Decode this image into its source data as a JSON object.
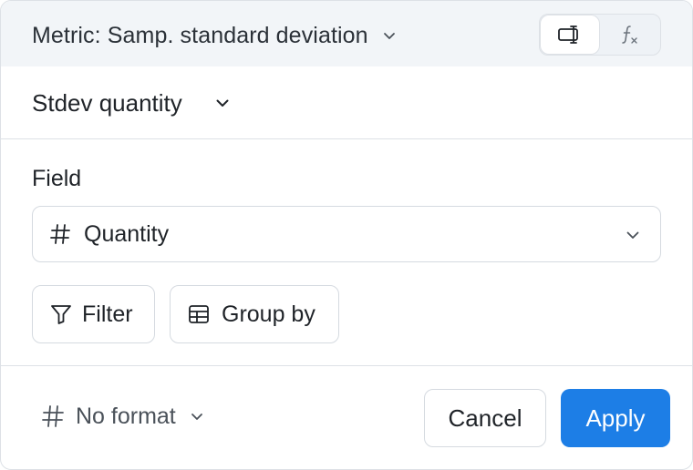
{
  "header": {
    "metric_label": "Metric: Samp. standard deviation",
    "mode_toggle": {
      "active_icon": "column-cursor-icon",
      "inactive_icon": "formula-fx-icon"
    }
  },
  "name_select": {
    "value": "Stdev quantity"
  },
  "field": {
    "label": "Field",
    "type_icon": "hash-icon",
    "value": "Quantity"
  },
  "actions": {
    "filter_label": "Filter",
    "group_by_label": "Group by"
  },
  "footer": {
    "format_value": "No format",
    "cancel_label": "Cancel",
    "apply_label": "Apply"
  },
  "colors": {
    "accent": "#1d7ee6",
    "header_bg": "#f2f5f8",
    "border": "#dde1e6"
  }
}
